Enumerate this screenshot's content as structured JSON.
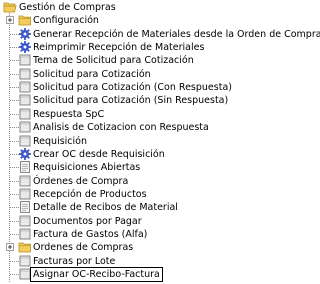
{
  "tree": {
    "root": {
      "label": "Gestión de Compras",
      "expanded": true,
      "icon": "folder-open-icon"
    },
    "items": [
      {
        "label": "Configuración",
        "icon": "folder-icon",
        "type": "folder",
        "expanded": false
      },
      {
        "label": "Generar Recepción de Materiales desde la Orden de Compra",
        "icon": "process-gear-icon",
        "type": "process"
      },
      {
        "label": "Reimprimir Recepción de Materiales",
        "icon": "process-gear-icon",
        "type": "process"
      },
      {
        "label": "Tema de Solicitud para Cotización",
        "icon": "window-icon",
        "type": "window"
      },
      {
        "label": "Solicitud para Cotización",
        "icon": "window-icon",
        "type": "window"
      },
      {
        "label": "Solicitud para Cotización (Con Respuesta)",
        "icon": "window-icon",
        "type": "window"
      },
      {
        "label": "Solicitud para Cotización  (Sin Respuesta)",
        "icon": "window-icon",
        "type": "window"
      },
      {
        "label": "Respuesta SpC",
        "icon": "window-icon",
        "type": "window"
      },
      {
        "label": "Analisis de Cotizacion con Respuesta",
        "icon": "window-icon",
        "type": "window"
      },
      {
        "label": "Requisición",
        "icon": "window-icon",
        "type": "window"
      },
      {
        "label": "Crear OC desde Requisición",
        "icon": "process-gear-icon",
        "type": "process"
      },
      {
        "label": "Requisiciones Abiertas",
        "icon": "report-icon",
        "type": "report"
      },
      {
        "label": "Órdenes de Compra",
        "icon": "window-icon",
        "type": "window"
      },
      {
        "label": "Recepción de Productos",
        "icon": "window-icon",
        "type": "window"
      },
      {
        "label": "Detalle de Recibos de Material",
        "icon": "report-icon",
        "type": "report"
      },
      {
        "label": "Documentos por Pagar",
        "icon": "window-icon",
        "type": "window"
      },
      {
        "label": "Factura de Gastos (Alfa)",
        "icon": "window-icon",
        "type": "window"
      },
      {
        "label": "Ordenes de Compras",
        "icon": "folder-icon",
        "type": "folder",
        "expanded": false
      },
      {
        "label": "Facturas por Lote",
        "icon": "window-icon",
        "type": "window"
      },
      {
        "label": "Asignar OC-Recibo-Factura",
        "icon": "window-icon",
        "type": "window",
        "selected": true
      }
    ]
  },
  "colors": {
    "folder": "#f2cd5c",
    "folder_dark": "#b8901d",
    "gear": "#3a56c9",
    "window_border": "#7a7a7a",
    "window_fill": "#e9e9e9",
    "selection_border": "#000000"
  }
}
